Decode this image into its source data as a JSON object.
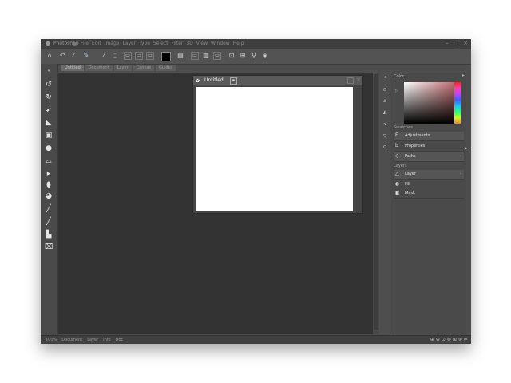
{
  "app": {
    "name": "Photoshop",
    "menus": [
      "File",
      "Edit",
      "Image",
      "Layer",
      "Type",
      "Select",
      "Filter",
      "3D",
      "View",
      "Window",
      "Help"
    ],
    "window_controls": [
      "–",
      "□",
      "×"
    ]
  },
  "toolbar": {
    "icons": [
      "home-icon",
      "back-icon",
      "pen-icon",
      "brush-icon",
      "eyedropper-icon",
      "tint-icon",
      "layers-icon",
      "crop-icon",
      "frame-icon",
      "color-swatch",
      "grid-icon",
      "align-left-icon",
      "align-center-icon",
      "align-right-icon",
      "transform-icon",
      "arrange-icon",
      "zoom-icon",
      "help-icon"
    ]
  },
  "doc_tabs": [
    {
      "label": "Untitled",
      "active": true
    },
    {
      "label": "Document"
    },
    {
      "label": "Layer"
    },
    {
      "label": "Canvas"
    },
    {
      "label": "Guides"
    }
  ],
  "document": {
    "title": "Untitled",
    "canvas_color": "#ffffff"
  },
  "right_panel": {
    "header": "Color",
    "section_label": "Swatches",
    "section2_label": "Layers",
    "rows_top": [
      {
        "label": "Adjustments",
        "icon": "F"
      },
      {
        "label": "Properties",
        "icon": "b"
      },
      {
        "label": "Paths",
        "icon": "◇"
      }
    ],
    "rows_bottom": [
      {
        "label": "Layer",
        "icon": "△"
      },
      {
        "label": "Fill",
        "icon": "◐"
      },
      {
        "label": "Mask",
        "icon": "◧"
      }
    ]
  },
  "status_bar": {
    "items": [
      "100%",
      "Document",
      "Layer",
      "Info",
      "Doc"
    ],
    "icons": [
      "zoom-in-icon",
      "zoom-out-icon",
      "fit-icon",
      "rotate-icon",
      "grid-icon",
      "settings-icon",
      "arrow-icon"
    ]
  },
  "colors": {
    "workspace": "#333333",
    "panel": "#4a4a4a",
    "chrome": "#535353"
  }
}
